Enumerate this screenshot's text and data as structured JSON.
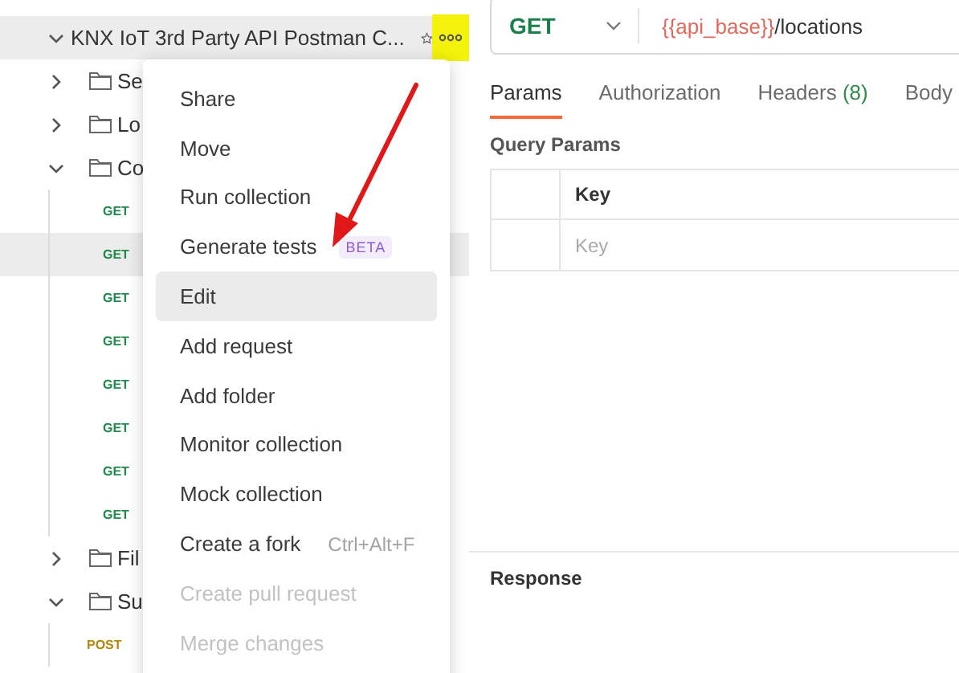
{
  "sidebar": {
    "collection": {
      "name": "KNX IoT 3rd Party API Postman C...",
      "expanded": true
    },
    "items": [
      {
        "kind": "folder",
        "name": "Se",
        "expanded": false
      },
      {
        "kind": "folder",
        "name": "Lo",
        "expanded": false
      },
      {
        "kind": "folder",
        "name": "Co",
        "expanded": true,
        "children": [
          {
            "kind": "request",
            "method": "GET",
            "selected": false
          },
          {
            "kind": "request",
            "method": "GET",
            "selected": true
          },
          {
            "kind": "request",
            "method": "GET",
            "selected": false
          },
          {
            "kind": "request",
            "method": "GET",
            "selected": false
          },
          {
            "kind": "request",
            "method": "GET",
            "selected": false
          },
          {
            "kind": "request",
            "method": "GET",
            "selected": false
          },
          {
            "kind": "request",
            "method": "GET",
            "selected": false
          },
          {
            "kind": "request",
            "method": "GET",
            "selected": false
          }
        ]
      },
      {
        "kind": "folder",
        "name": "Fil",
        "expanded": false
      },
      {
        "kind": "folder",
        "name": "Su",
        "expanded": true,
        "children": [
          {
            "kind": "request",
            "method": "POST",
            "selected": false
          }
        ]
      }
    ]
  },
  "context_menu": [
    {
      "label": "Share",
      "highlighted": false,
      "disabled": false
    },
    {
      "label": "Move",
      "highlighted": false,
      "disabled": false
    },
    {
      "label": "Run collection",
      "highlighted": false,
      "disabled": false
    },
    {
      "label": "Generate tests",
      "badge": "BETA",
      "highlighted": false,
      "disabled": false
    },
    {
      "label": "Edit",
      "highlighted": true,
      "disabled": false
    },
    {
      "label": "Add request",
      "highlighted": false,
      "disabled": false
    },
    {
      "label": "Add folder",
      "highlighted": false,
      "disabled": false
    },
    {
      "label": "Monitor collection",
      "highlighted": false,
      "disabled": false
    },
    {
      "label": "Mock collection",
      "highlighted": false,
      "disabled": false
    },
    {
      "label": "Create a fork",
      "shortcut": "Ctrl+Alt+F",
      "highlighted": false,
      "disabled": false
    },
    {
      "label": "Create pull request",
      "highlighted": false,
      "disabled": true
    },
    {
      "label": "Merge changes",
      "highlighted": false,
      "disabled": true
    }
  ],
  "request": {
    "method": "GET",
    "url_variable": "{{api_base}}",
    "url_path": "/locations",
    "tabs": [
      {
        "label": "Params",
        "selected": true
      },
      {
        "label": "Authorization",
        "selected": false
      },
      {
        "label": "Headers",
        "count": "(8)",
        "selected": false
      },
      {
        "label": "Body",
        "selected": false
      }
    ],
    "query_params": {
      "title": "Query Params",
      "column": "Key",
      "placeholder": "Key"
    }
  },
  "response": {
    "title": "Response"
  }
}
